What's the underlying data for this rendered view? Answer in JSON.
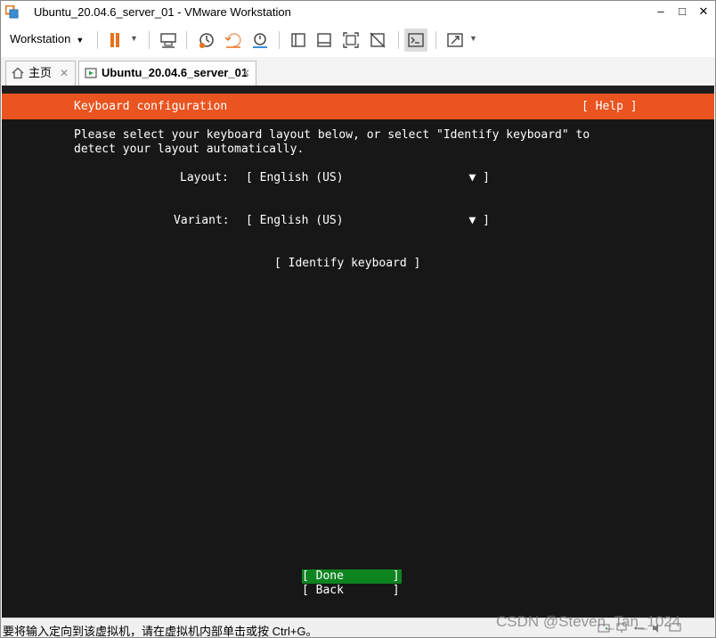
{
  "window": {
    "title": "Ubuntu_20.04.6_server_01 - VMware Workstation",
    "minimize": "–",
    "maximize": "□",
    "close": "✕"
  },
  "toolbar": {
    "menu_label": "Workstation",
    "icons": [
      "pause-icon",
      "send-ctrl-alt-del-icon",
      "snapshot-icon",
      "revert-snapshot-icon",
      "snapshot-manager-icon",
      "library-icon",
      "thumbnail-bar-icon",
      "fullscreen-icon",
      "unity-icon",
      "console-view-icon",
      "stretch-icon"
    ]
  },
  "tabs": [
    {
      "label": "主页",
      "close": "✕"
    },
    {
      "label": "Ubuntu_20.04.6_server_01",
      "close": "✕"
    }
  ],
  "installer": {
    "header_title": "Keyboard configuration",
    "help": "[ Help ]",
    "instructions_line1": "Please select your keyboard layout below, or select \"Identify keyboard\" to",
    "instructions_line2": "detect your layout automatically.",
    "layout_label": "Layout:",
    "layout_value": "[ English (US)                  ▼ ]",
    "variant_label": "Variant:",
    "variant_value": "[ English (US)                  ▼ ]",
    "identify_button": "[ Identify keyboard ]",
    "done_button": "[ Done       ]",
    "back_button": "[ Back       ]"
  },
  "status": {
    "text": "要将输入定向到该虚拟机，请在虚拟机内部单击或按 Ctrl+G。",
    "watermark": "CSDN @Steven_Tan_1024"
  },
  "colors": {
    "accent_orange": "#e95420",
    "done_green": "#0e8420",
    "console_bg": "#171717"
  }
}
